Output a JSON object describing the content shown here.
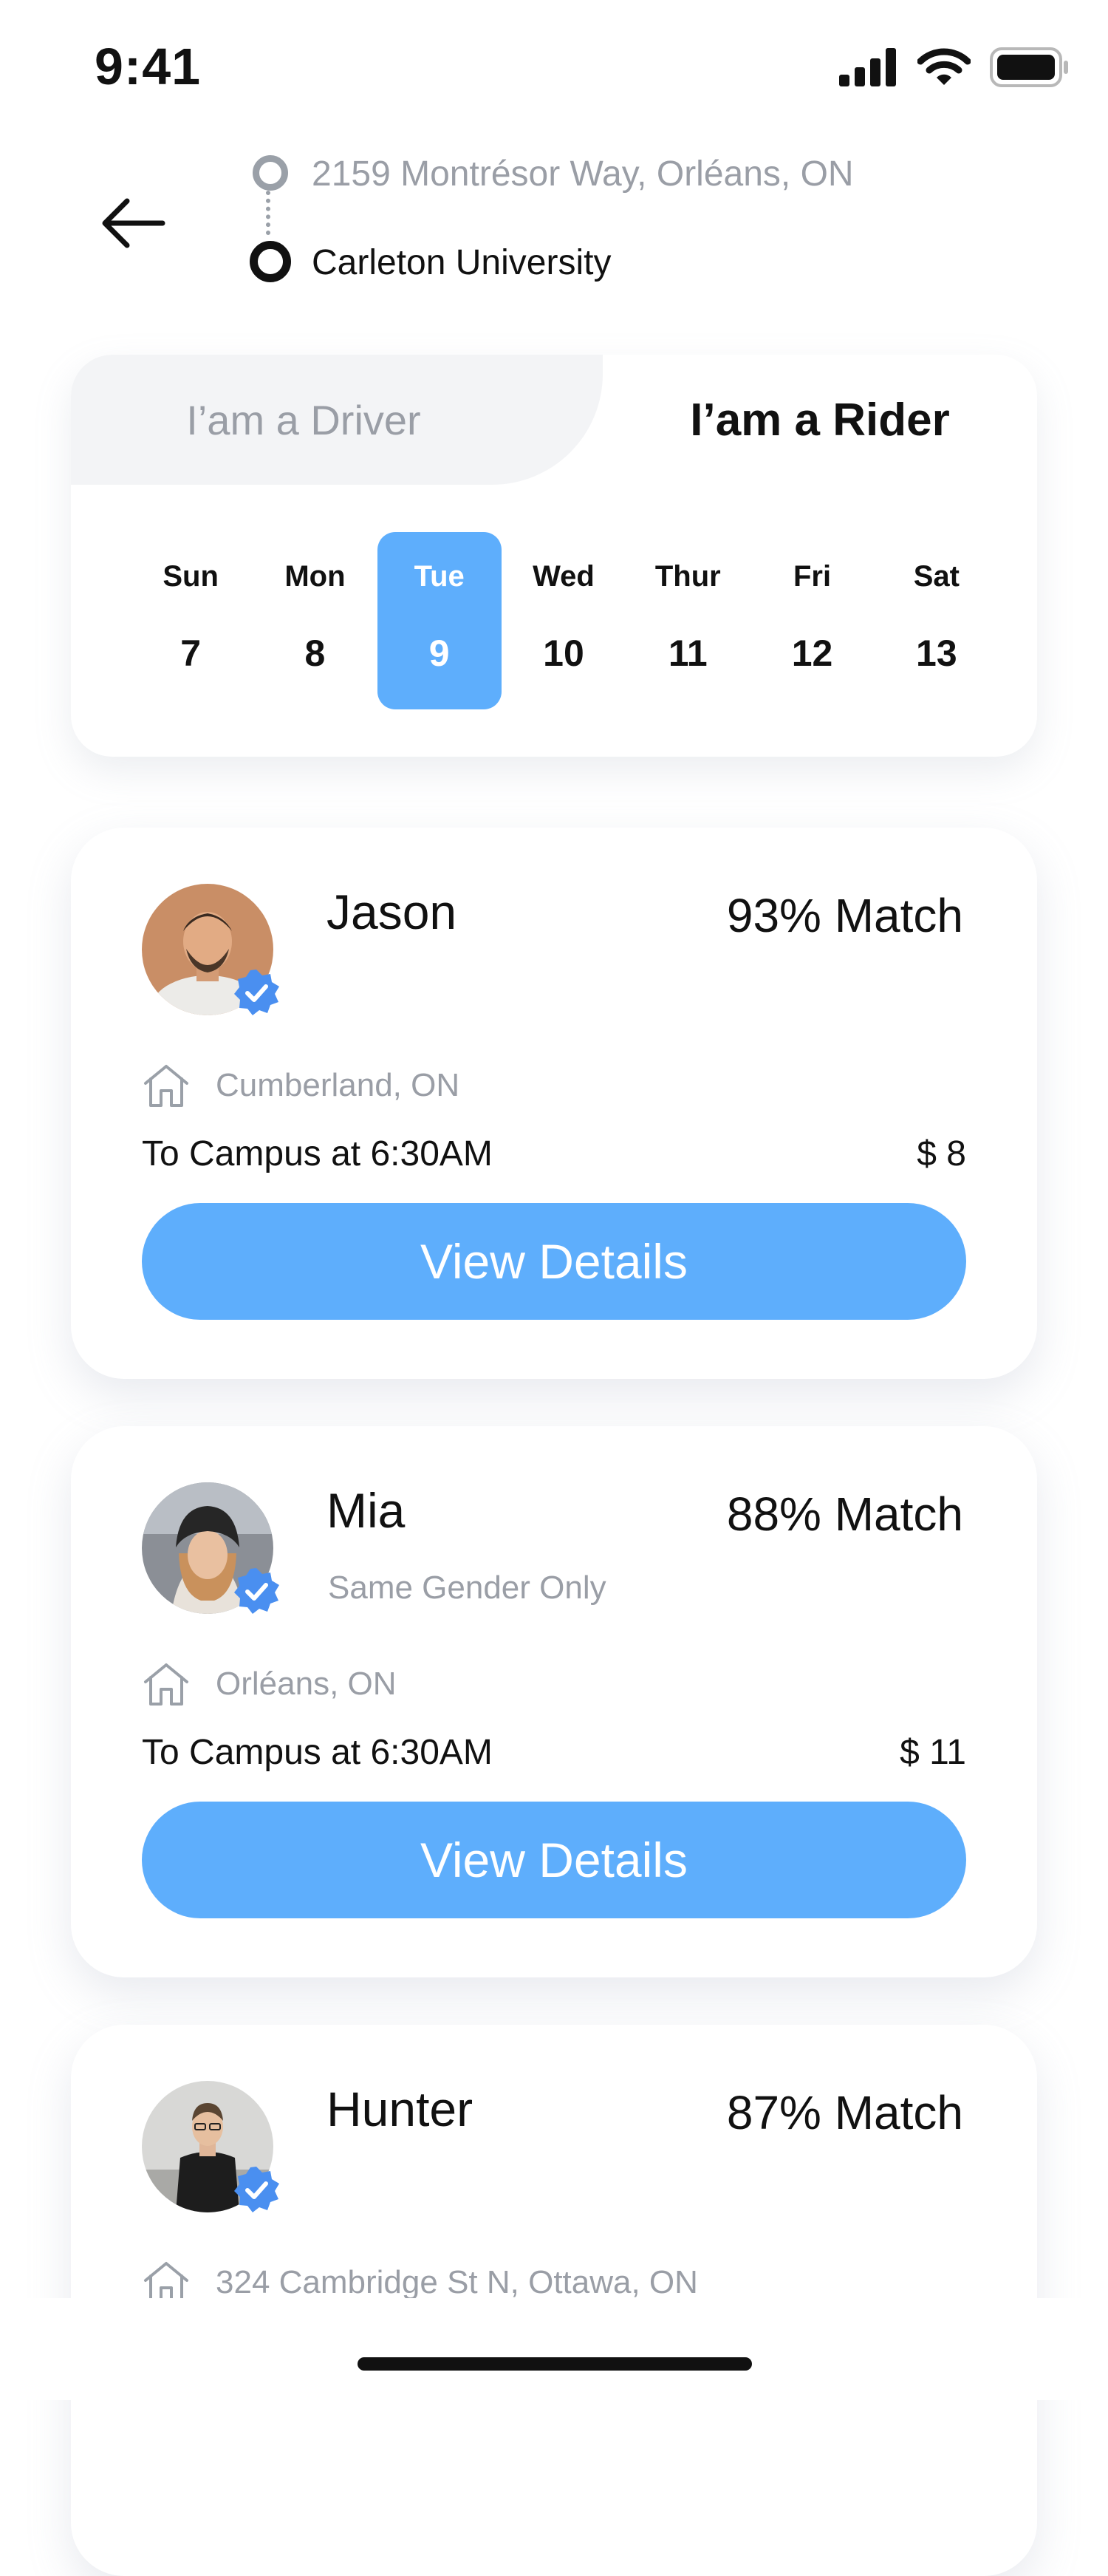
{
  "status_bar": {
    "time": "9:41"
  },
  "route": {
    "origin": "2159 Montrésor Way, Orléans, ON",
    "destination": "Carleton University"
  },
  "mode_tabs": {
    "driver": "I’am a Driver",
    "rider": "I’am a Rider",
    "active": "rider"
  },
  "week": [
    {
      "name": "Sun",
      "date": "7"
    },
    {
      "name": "Mon",
      "date": "8"
    },
    {
      "name": "Tue",
      "date": "9",
      "selected": true
    },
    {
      "name": "Wed",
      "date": "10"
    },
    {
      "name": "Thur",
      "date": "11"
    },
    {
      "name": "Fri",
      "date": "12"
    },
    {
      "name": "Sat",
      "date": "13"
    }
  ],
  "rides": [
    {
      "name": "Jason",
      "match": "93% Match",
      "preference": "",
      "location": "Cumberland, ON",
      "trip": "To Campus at 6:30AM",
      "price": "$ 8",
      "button": "View Details"
    },
    {
      "name": "Mia",
      "match": "88% Match",
      "preference": "Same Gender Only",
      "location": "Orléans, ON",
      "trip": "To Campus at 6:30AM",
      "price": "$ 11",
      "button": "View Details"
    },
    {
      "name": "Hunter",
      "match": "87% Match",
      "preference": "",
      "location": "324 Cambridge St N, Ottawa, ON",
      "trip": "",
      "price": "",
      "button": ""
    }
  ],
  "colors": {
    "accent": "#5eaefc",
    "muted_text": "#9a9ea6",
    "verified_badge": "#4a8ff0"
  },
  "icons": {
    "back": "arrow-left-icon",
    "home": "house-icon",
    "verified": "verified-badge-icon"
  }
}
